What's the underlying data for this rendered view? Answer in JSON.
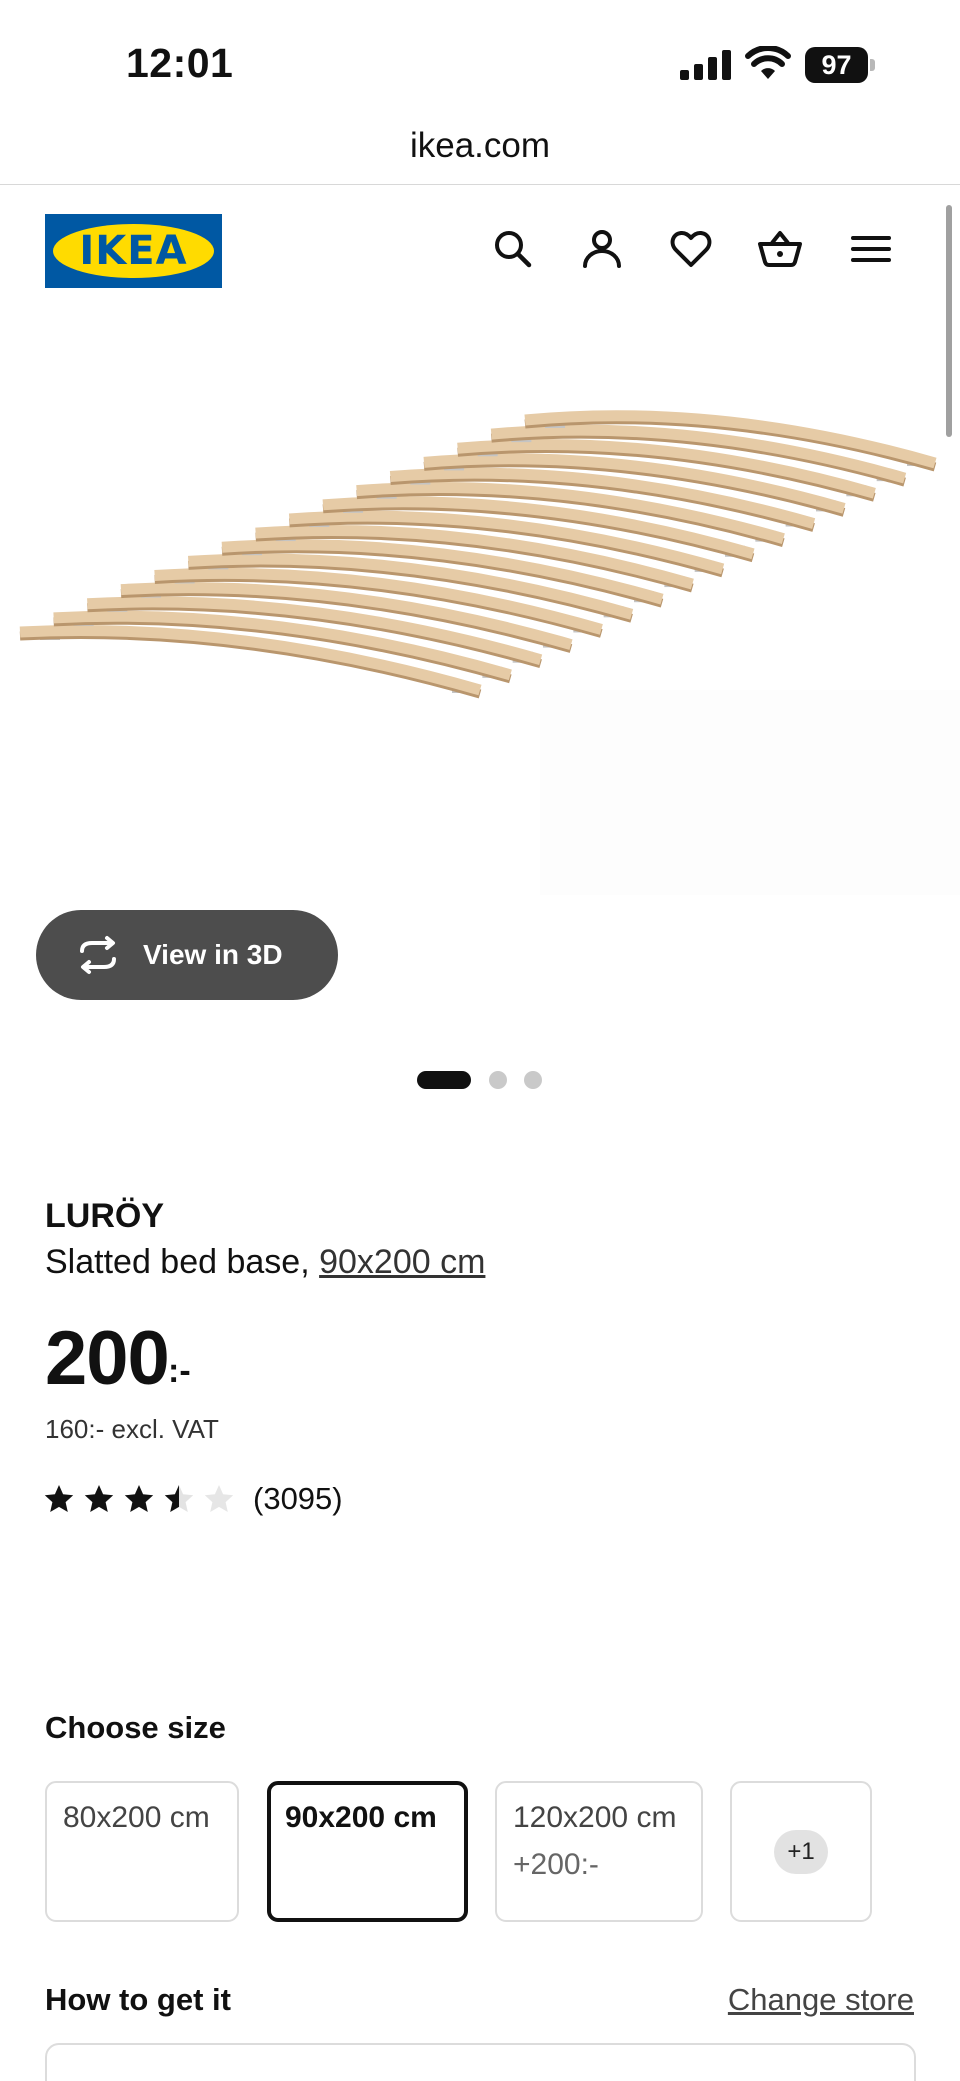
{
  "status_bar": {
    "time": "12:01",
    "battery": "97"
  },
  "browser": {
    "url": "ikea.com"
  },
  "header": {
    "logo_text": "IKEA",
    "icons": [
      "search-icon",
      "account-icon",
      "heart-icon",
      "basket-icon",
      "menu-icon"
    ]
  },
  "gallery": {
    "view_3d_label": "View in 3D",
    "dots": 3,
    "active_dot": 1
  },
  "product": {
    "name": "LURÖY",
    "description": "Slatted bed base, ",
    "size_link": "90x200 cm",
    "price": "200",
    "price_suffix": ":-",
    "price_excl_vat": "160:- excl. VAT",
    "rating": 3.5,
    "rating_max": 5,
    "review_count": "(3095)"
  },
  "size_section": {
    "title": "Choose size",
    "options": [
      {
        "label": "80x200 cm",
        "delta": "",
        "selected": false
      },
      {
        "label": "90x200 cm",
        "delta": "",
        "selected": true
      },
      {
        "label": "120x200 cm",
        "delta": "+200:-",
        "selected": false
      }
    ],
    "more_label": "+1"
  },
  "delivery_section": {
    "title": "How to get it",
    "change_store_label": "Change store"
  },
  "colors": {
    "ikea_blue": "#0058a3",
    "ikea_yellow": "#ffdb00",
    "button_dark": "#4d4d4d",
    "wood": "#e6cba6"
  }
}
